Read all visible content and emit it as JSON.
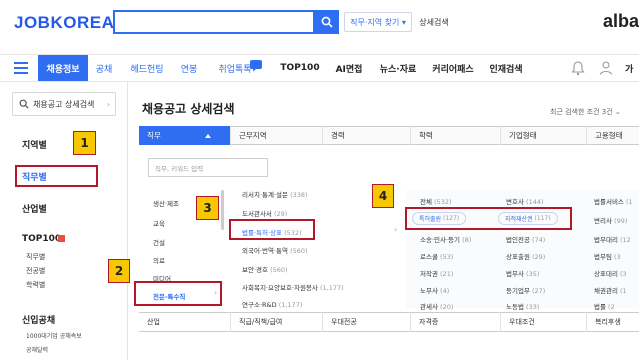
{
  "header": {
    "logo": "JOBKOREA",
    "search_placeholder": "",
    "job_area_btn": "직무·지역 찾기 ▾",
    "detail_btn": "상세검색",
    "brand_right": "alba"
  },
  "nav": {
    "items": [
      "채용정보",
      "공채",
      "헤드헌팅",
      "연봉",
      "취업톡톡",
      "TOP100",
      "AI면접",
      "뉴스·자료",
      "커리어패스",
      "인재검색"
    ],
    "extra": "가"
  },
  "sidebar": {
    "search_btn": "채용공고 상세검색",
    "region": "지역별",
    "job": "직무별",
    "industry": "산업별",
    "top100": "TOP100",
    "top100_sub": [
      "직무별",
      "전공별",
      "학력별"
    ],
    "gongchae": "신입공채",
    "gongchae_sub": [
      "1000대기업 공채속보",
      "공채달력"
    ]
  },
  "main": {
    "title": "채용공고 상세검색",
    "recent": "최근 검색한 조건 3건",
    "headers": [
      "직무",
      "근무지역",
      "경력",
      "학력",
      "기업형태",
      "고용형태"
    ],
    "filter_placeholder": "직무, 키워드 입력",
    "col1": [
      "생산·제조",
      "교육",
      "건설",
      "의료",
      "미디어",
      "전문·특수직"
    ],
    "col2": [
      {
        "label": "리서치·통계·설문",
        "count": "(338)"
      },
      {
        "label": "도서관사서",
        "count": "(29)"
      },
      {
        "label": "법률·특허·상표",
        "count": "(532)"
      },
      {
        "label": "외국어·번역·통역",
        "count": "(560)"
      },
      {
        "label": "보안·경호",
        "count": "(560)"
      },
      {
        "label": "사회복지·요양보호·자원봉사",
        "count": "(1,177)"
      },
      {
        "label": "연구소·R&D",
        "count": "(1,177)"
      }
    ],
    "col3": [
      {
        "label": "전체",
        "count": "(532)"
      },
      {
        "label": "특허출원",
        "count": "(127)"
      },
      {
        "label": "소송·민사·등기",
        "count": "(8)"
      },
      {
        "label": "로스쿨",
        "count": "(53)"
      },
      {
        "label": "저작권",
        "count": "(21)"
      },
      {
        "label": "노무사",
        "count": "(4)"
      },
      {
        "label": "관세사",
        "count": "(20)"
      }
    ],
    "col4": [
      {
        "label": "변호사",
        "count": "(144)"
      },
      {
        "label": "지적재산권",
        "count": "(117)"
      },
      {
        "label": "법인전공",
        "count": "(74)"
      },
      {
        "label": "상표출원",
        "count": "(29)"
      },
      {
        "label": "법무사",
        "count": "(35)"
      },
      {
        "label": "등기업무",
        "count": "(27)"
      },
      {
        "label": "노동법",
        "count": "(33)"
      }
    ],
    "col5": [
      {
        "label": "법률서비스",
        "count": "(1"
      },
      {
        "label": "변리사",
        "count": "(99)"
      },
      {
        "label": "법무대리",
        "count": "(12"
      },
      {
        "label": "법무팀",
        "count": "(3"
      },
      {
        "label": "상표대리",
        "count": "(3"
      },
      {
        "label": "채권관리",
        "count": "(1"
      },
      {
        "label": "법률",
        "count": "(2"
      }
    ],
    "bottom": [
      "산업",
      "직급/직책/급여",
      "우대전공",
      "자격증",
      "우대조건",
      "복리후생"
    ]
  },
  "callouts": [
    "1",
    "2",
    "3",
    "4"
  ],
  "colors": {
    "accent": "#2f6ef0",
    "callout_border": "#b3182a",
    "badge": "#f7c800"
  }
}
